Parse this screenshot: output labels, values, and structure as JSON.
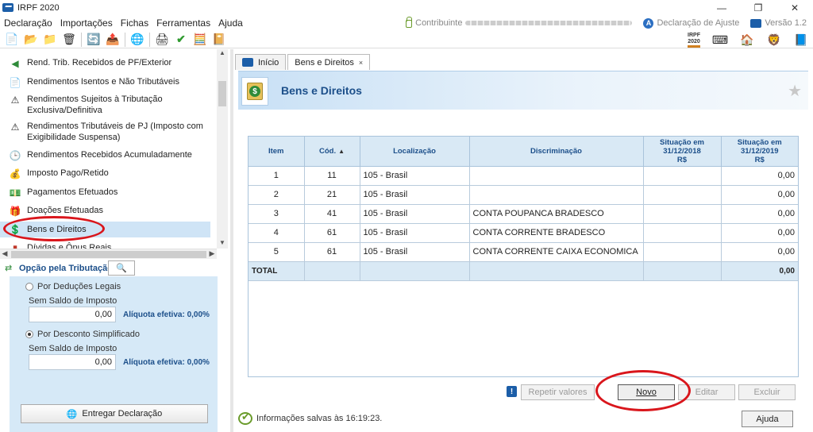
{
  "window": {
    "title": "IRPF 2020",
    "min": "—",
    "max": "❐",
    "close": "✕"
  },
  "menu": {
    "items": [
      "Declaração",
      "Importações",
      "Fichas",
      "Ferramentas",
      "Ajuda"
    ],
    "contribuinte_label": "Contribuinte",
    "declaracao_label": "Declaração de Ajuste",
    "versao_label": "Versão 1.2"
  },
  "toolbar": {
    "irpf_badge_line1": "IRPF",
    "irpf_badge_line2": "2020"
  },
  "sidebar": {
    "items": [
      {
        "label": "Rend. Trib. Recebidos de PF/Exterior",
        "icon": "income-arrow-icon"
      },
      {
        "label": "Rendimentos Isentos e Não Tributáveis",
        "icon": "document-check-icon"
      },
      {
        "label": "Rendimentos Sujeitos à Tributação Exclusiva/Definitiva",
        "icon": "document-warning-icon"
      },
      {
        "label": "Rendimentos Tributáveis de PJ (Imposto com Exigibilidade Suspensa)",
        "icon": "document-warning-icon"
      },
      {
        "label": "Rendimentos Recebidos Acumuladamente",
        "icon": "document-clock-icon"
      },
      {
        "label": "Imposto Pago/Retido",
        "icon": "coin-hand-icon"
      },
      {
        "label": "Pagamentos Efetuados",
        "icon": "money-bill-icon"
      },
      {
        "label": "Doações Efetuadas",
        "icon": "donation-icon"
      },
      {
        "label": "Bens e Direitos",
        "icon": "money-bag-icon"
      },
      {
        "label": "Dívidas e Ônus Reais",
        "icon": "debt-icon"
      }
    ]
  },
  "tributacao": {
    "title": "Opção pela Tributação:",
    "option1_label": "Por Deduções Legais",
    "option1_sub": "Sem Saldo de Imposto",
    "option1_value": "0,00",
    "option1_aliquota": "Alíquota efetiva: 0,00%",
    "option2_label": "Por Desconto Simplificado",
    "option2_sub": "Sem Saldo de Imposto",
    "option2_value": "0,00",
    "option2_aliquota": "Alíquota efetiva: 0,00%",
    "selected": "option2",
    "deliver_label": "Entregar Declaração"
  },
  "tabs": [
    {
      "label": "Início"
    },
    {
      "label": "Bens e Direitos",
      "close": "×"
    }
  ],
  "page": {
    "title": "Bens e Direitos"
  },
  "table": {
    "headers": {
      "item": "Item",
      "cod": "Cód.",
      "localizacao": "Localização",
      "discriminacao": "Discriminação",
      "sit2018": "Situação em 31/12/2018 R$",
      "sit2019": "Situação em 31/12/2019 R$"
    },
    "rows": [
      {
        "item": "1",
        "cod": "11",
        "loc": "105 - Brasil",
        "disc": "",
        "v2018": "",
        "v2019": "0,00"
      },
      {
        "item": "2",
        "cod": "21",
        "loc": "105 - Brasil",
        "disc": "",
        "v2018": "",
        "v2019": "0,00"
      },
      {
        "item": "3",
        "cod": "41",
        "loc": "105 - Brasil",
        "disc": "CONTA POUPANCA BRADESCO",
        "v2018": "",
        "v2019": "0,00"
      },
      {
        "item": "4",
        "cod": "61",
        "loc": "105 - Brasil",
        "disc": "CONTA CORRENTE BRADESCO",
        "v2018": "",
        "v2019": "0,00"
      },
      {
        "item": "5",
        "cod": "61",
        "loc": "105 - Brasil",
        "disc": "CONTA CORRENTE CAIXA ECONOMICA",
        "v2018": "",
        "v2019": "0,00"
      }
    ],
    "total_label": "TOTAL",
    "total_2019": "0,00"
  },
  "actions": {
    "repetir": "Repetir valores",
    "novo": "Novo",
    "editar": "Editar",
    "excluir": "Excluir"
  },
  "status": {
    "text": "Informações salvas às 16:19:23.",
    "help": "Ajuda"
  },
  "colors": {
    "accent": "#1c4f8a",
    "panel": "#d6e9f7",
    "annotation": "#d9161c"
  }
}
